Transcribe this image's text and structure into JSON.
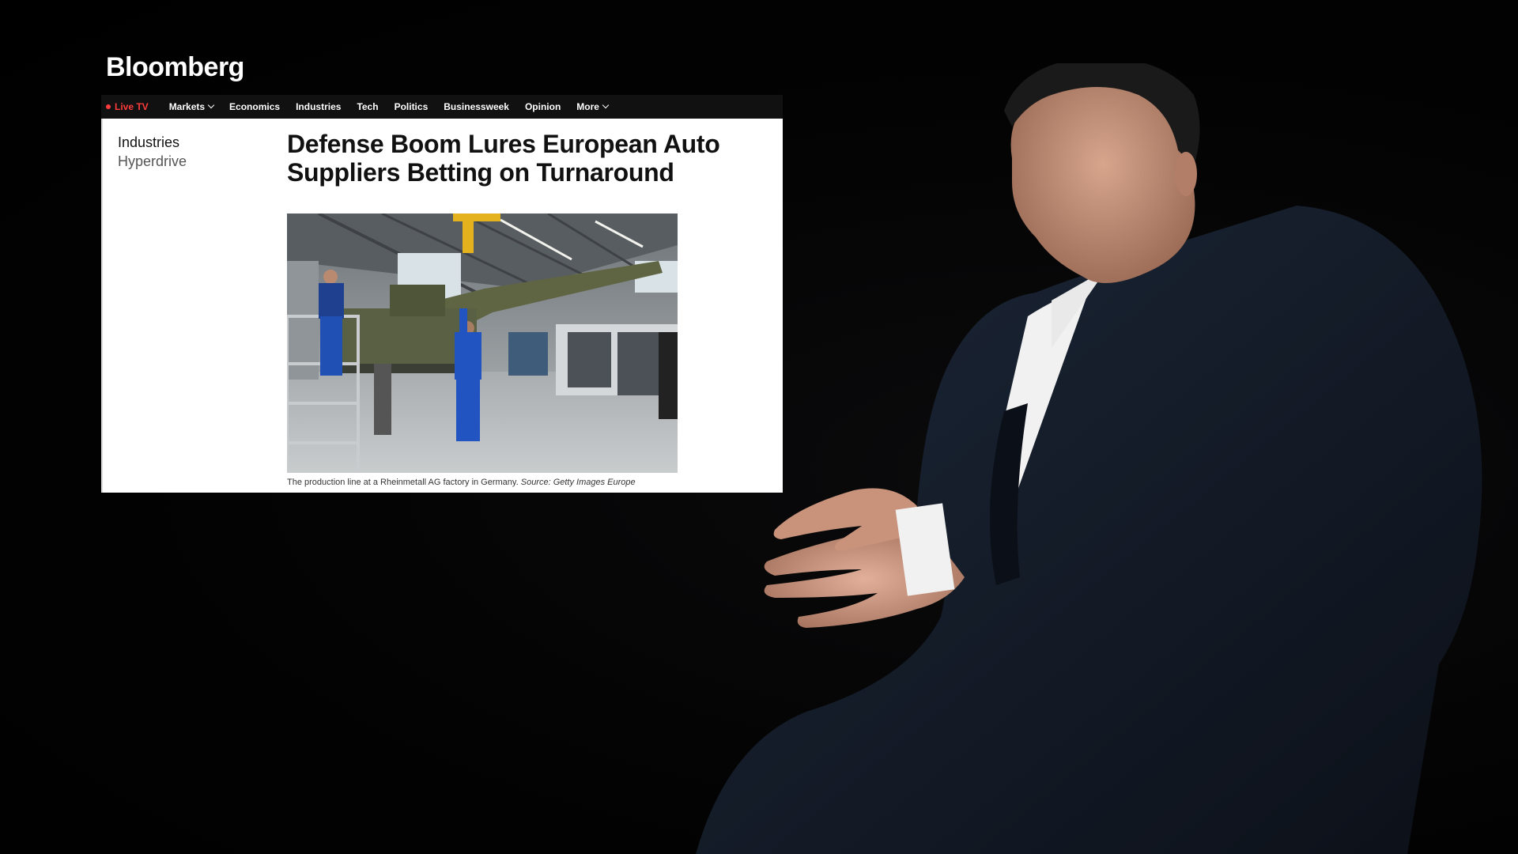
{
  "brand": {
    "logo_text": "Bloomberg"
  },
  "nav": {
    "items": [
      {
        "label": "Live TV",
        "type": "live"
      },
      {
        "label": "Markets",
        "dropdown": true
      },
      {
        "label": "Economics"
      },
      {
        "label": "Industries"
      },
      {
        "label": "Tech"
      },
      {
        "label": "Politics"
      },
      {
        "label": "Businessweek"
      },
      {
        "label": "Opinion"
      },
      {
        "label": "More",
        "dropdown": true
      }
    ]
  },
  "article": {
    "section": "Industries",
    "subsection": "Hyperdrive",
    "headline": "Defense Boom Lures European Auto Suppliers Betting on Turnaround",
    "image_caption": "The production line at a Rheinmetall AG factory in Germany.",
    "image_source": "Source: Getty Images Europe"
  },
  "colors": {
    "live_accent": "#ff3b3b",
    "navbar_bg": "#111111",
    "page_bg": "#ffffff",
    "stage_bg": "#000000"
  }
}
